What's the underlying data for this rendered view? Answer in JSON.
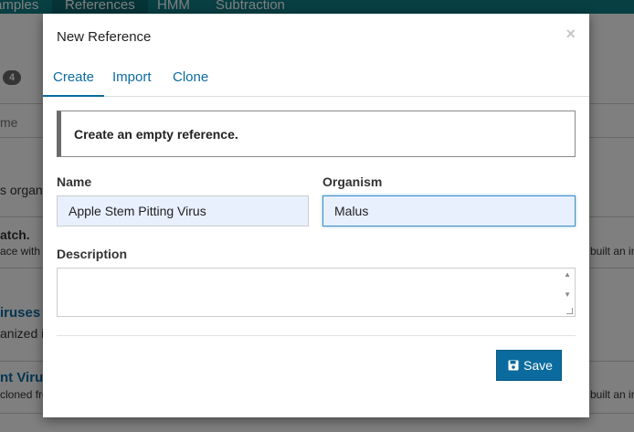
{
  "background": {
    "nav": [
      "amples",
      "References",
      "HMM",
      "Subtraction"
    ],
    "badge": "4",
    "fragments": {
      "name_header": "me",
      "organized": "s organiz",
      "batch_title": "atch.",
      "batch_desc": "ace with C",
      "viruses_title": "iruses",
      "viruses_desc": "anized i",
      "plant_title": "nt Viruse",
      "plant_desc": "cloned fro",
      "built_an_1": "built an in",
      "built_an_2": "built an in"
    }
  },
  "modal": {
    "title": "New Reference",
    "close": "×",
    "tabs": [
      {
        "label": "Create",
        "active": true
      },
      {
        "label": "Import",
        "active": false
      },
      {
        "label": "Clone",
        "active": false
      }
    ],
    "info": "Create an empty reference.",
    "fields": {
      "name": {
        "label": "Name",
        "value": "Apple Stem Pitting Virus"
      },
      "organism": {
        "label": "Organism",
        "value": "Malus"
      },
      "description": {
        "label": "Description",
        "value": ""
      }
    },
    "save_label": "Save"
  },
  "colors": {
    "primary": "#0b6b9e",
    "nav": "#0f7f86",
    "input_fill": "#e8f0fe"
  }
}
